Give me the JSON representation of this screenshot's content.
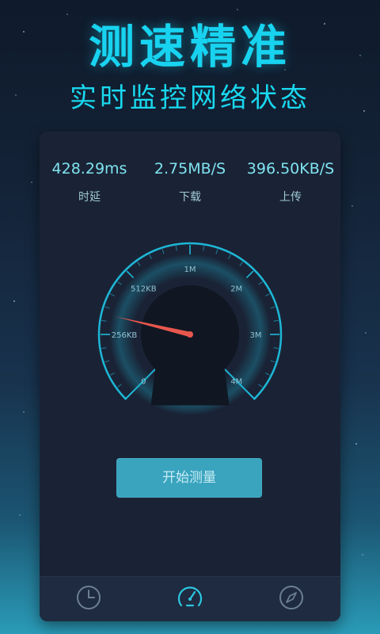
{
  "hero": {
    "title": "测速精准",
    "subtitle": "实时监控网络状态"
  },
  "stats": [
    {
      "value": "428.29ms",
      "label": "时延"
    },
    {
      "value": "2.75MB/S",
      "label": "下载"
    },
    {
      "value": "396.50KB/S",
      "label": "上传"
    }
  ],
  "gauge": {
    "tick_labels": [
      "0",
      "256KB",
      "512KB",
      "1M",
      "2M",
      "3M",
      "4M"
    ],
    "needle_tick_position": 1.3,
    "colors": {
      "ring": "#1fc0e0",
      "needle": "#e8574d"
    }
  },
  "button": {
    "label": "开始测量"
  },
  "tabs": [
    {
      "icon": "clock-icon",
      "active": false
    },
    {
      "icon": "speedometer-icon",
      "active": true
    },
    {
      "icon": "compass-icon",
      "active": false
    }
  ]
}
